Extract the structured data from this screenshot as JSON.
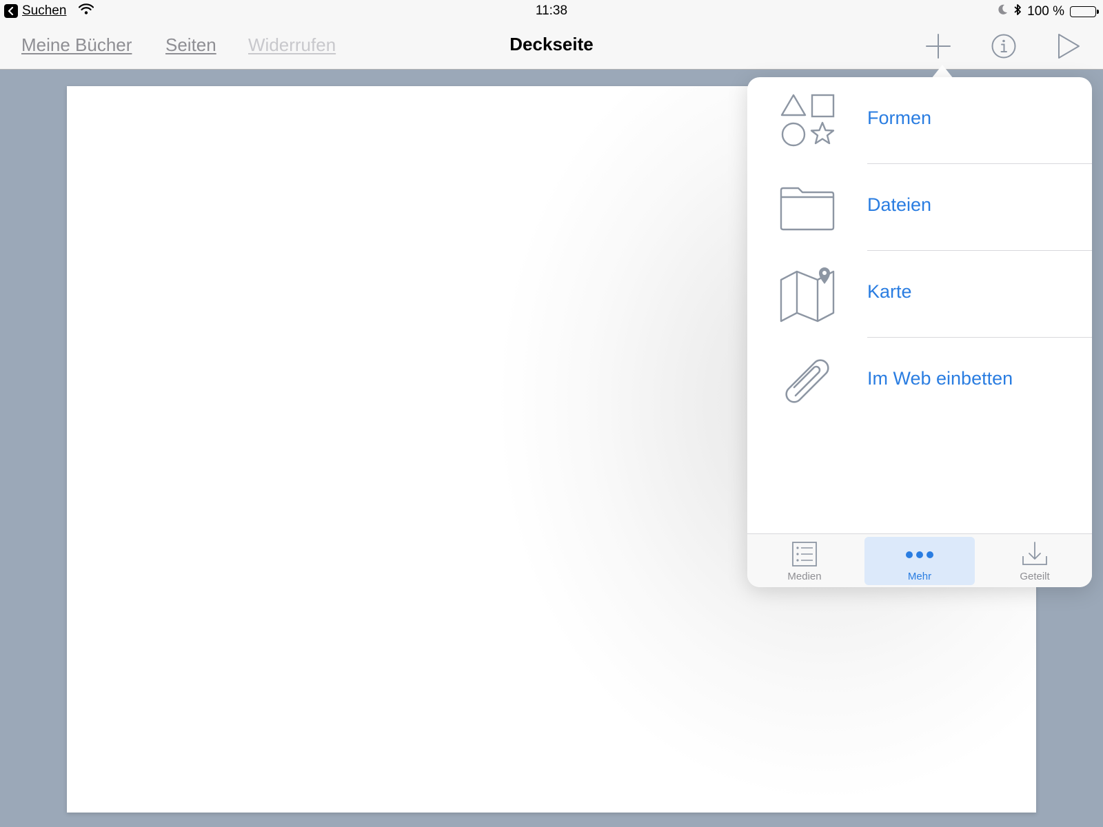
{
  "status_bar": {
    "back_label": "Suchen",
    "time": "11:38",
    "battery": "100 %"
  },
  "nav": {
    "left_links": [
      "Meine Bücher",
      "Seiten",
      "Widerrufen"
    ],
    "title": "Deckseite"
  },
  "popover": {
    "items": [
      {
        "label": "Formen",
        "icon": "shapes-icon"
      },
      {
        "label": "Dateien",
        "icon": "folder-icon"
      },
      {
        "label": "Karte",
        "icon": "map-icon"
      },
      {
        "label": "Im Web einbetten",
        "icon": "link-icon"
      }
    ],
    "tabs": [
      {
        "label": "Medien",
        "icon": "list-icon",
        "active": false
      },
      {
        "label": "Mehr",
        "icon": "more-icon",
        "active": true
      },
      {
        "label": "Geteilt",
        "icon": "download-icon",
        "active": false
      }
    ]
  },
  "colors": {
    "accent": "#2a7de1",
    "icon_gray": "#8d96a3",
    "background": "#9ba8b8"
  }
}
